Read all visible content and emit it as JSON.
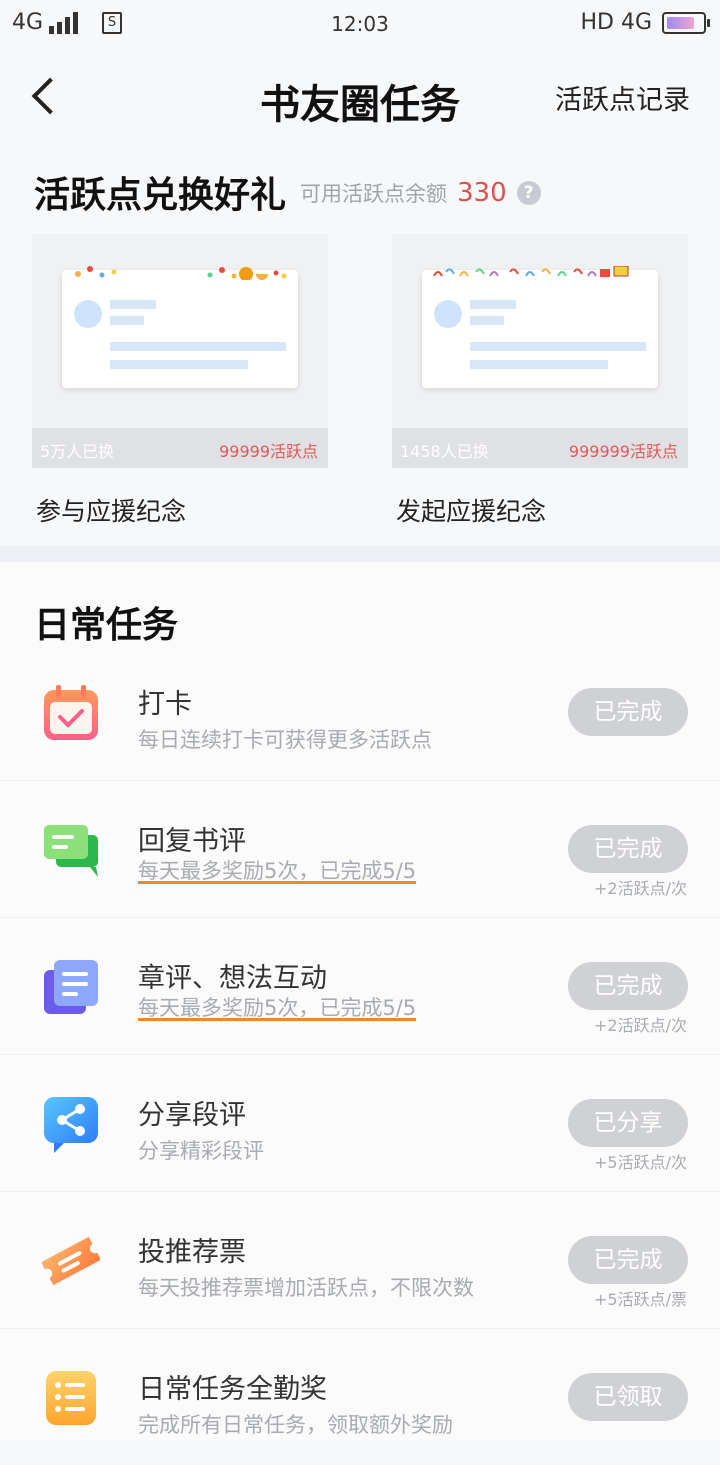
{
  "status_bar": {
    "network_left": "4G",
    "sim_icon_label": "S",
    "time": "12:03",
    "network_right": "HD 4G",
    "battery_level": 0.8
  },
  "navbar": {
    "title": "书友圈任务",
    "record_link": "活跃点记录"
  },
  "exchange": {
    "title": "活跃点兑换好礼",
    "balance_label": "可用活跃点余额",
    "balance_value": "330",
    "help_icon": "?",
    "gifts": [
      {
        "count": "5万人已换",
        "points": "99999活跃点",
        "name": "参与应援纪念"
      },
      {
        "count": "1458人已换",
        "points": "999999活跃点",
        "name": "发起应援纪念"
      }
    ]
  },
  "daily": {
    "title": "日常任务",
    "tasks": [
      {
        "name": "打卡",
        "desc": "每日连续打卡可获得更多活跃点",
        "button": "已完成",
        "reward": "",
        "icon": "calendar-check-icon"
      },
      {
        "name": "回复书评",
        "desc": "每天最多奖励5次，已完成5/5",
        "button": "已完成",
        "reward": "+2活跃点/次",
        "icon": "chat-bubbles-icon"
      },
      {
        "name": "章评、想法互动",
        "desc": "每天最多奖励5次，已完成5/5",
        "button": "已完成",
        "reward": "+2活跃点/次",
        "icon": "notes-stack-icon"
      },
      {
        "name": "分享段评",
        "desc": "分享精彩段评",
        "button": "已分享",
        "reward": "+5活跃点/次",
        "icon": "share-icon"
      },
      {
        "name": "投推荐票",
        "desc": "每天投推荐票增加活跃点，不限次数",
        "button": "已完成",
        "reward": "+5活跃点/票",
        "icon": "ticket-icon"
      },
      {
        "name": "日常任务全勤奖",
        "desc": "完成所有日常任务，领取额外奖励",
        "button": "已领取",
        "reward": "",
        "icon": "list-badge-icon"
      }
    ]
  },
  "colors": {
    "accent_red": "#e04f4f",
    "button_gray": "#cfd1d4",
    "underline_orange": "#ec8a2a"
  }
}
